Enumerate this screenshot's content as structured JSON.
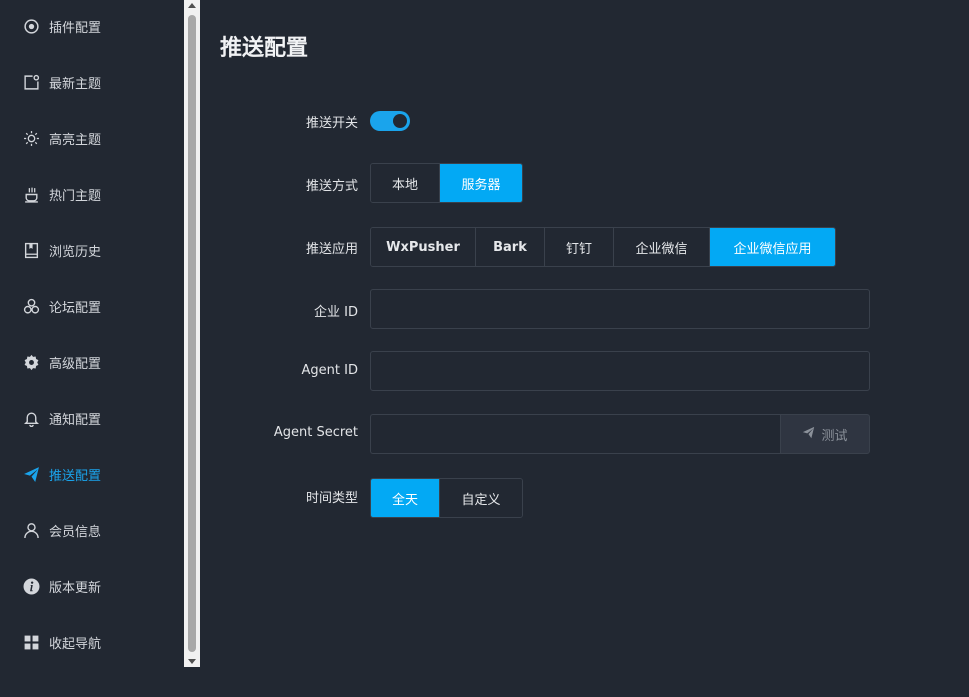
{
  "sidebar": {
    "items": [
      {
        "label": "插件配置",
        "icon": "plugin-gear-icon"
      },
      {
        "label": "最新主题",
        "icon": "new-topic-icon"
      },
      {
        "label": "高亮主题",
        "icon": "sun-icon"
      },
      {
        "label": "热门主题",
        "icon": "hot-cup-icon"
      },
      {
        "label": "浏览历史",
        "icon": "book-icon"
      },
      {
        "label": "论坛配置",
        "icon": "forum-icon"
      },
      {
        "label": "高级配置",
        "icon": "gear-icon"
      },
      {
        "label": "通知配置",
        "icon": "bell-icon"
      },
      {
        "label": "推送配置",
        "icon": "send-icon",
        "active": true
      },
      {
        "label": "会员信息",
        "icon": "user-icon"
      },
      {
        "label": "版本更新",
        "icon": "info-icon"
      },
      {
        "label": "收起导航",
        "icon": "grid-icon"
      }
    ],
    "active_color": "#1aa4ec"
  },
  "page": {
    "title": "推送配置"
  },
  "form": {
    "push_switch": {
      "label": "推送开关",
      "on": true
    },
    "push_method": {
      "label": "推送方式",
      "options": [
        "本地",
        "服务器"
      ],
      "selected": "服务器"
    },
    "push_app": {
      "label": "推送应用",
      "options": [
        "WxPusher",
        "Bark",
        "钉钉",
        "企业微信",
        "企业微信应用"
      ],
      "selected": "企业微信应用"
    },
    "corp_id": {
      "label": "企业 ID",
      "value": ""
    },
    "agent_id": {
      "label": "Agent ID",
      "value": ""
    },
    "agent_secret": {
      "label": "Agent Secret",
      "value": "",
      "test_button": "测试"
    },
    "time_type": {
      "label": "时间类型",
      "options": [
        "全天",
        "自定义"
      ],
      "selected": "全天"
    }
  },
  "colors": {
    "background": "#222832",
    "accent": "#03a9f4"
  }
}
